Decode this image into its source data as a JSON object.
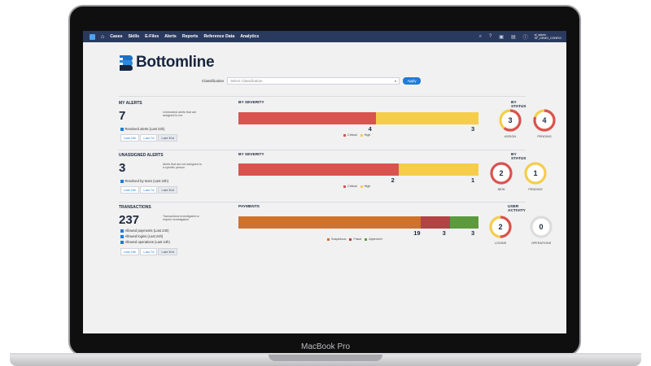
{
  "device": {
    "model": "MacBook Pro"
  },
  "nav": {
    "home_icon": "home-icon",
    "items": [
      "Cases",
      "Skills",
      "E-Files",
      "Alerts",
      "Reports",
      "Reference Data",
      "Analytics"
    ],
    "icons": [
      "search-icon",
      "help-icon",
      "briefcase-icon",
      "print-icon",
      "info-icon"
    ],
    "user_line1": "sf_admin",
    "user_line2": "SF_DEMO_CONFIG"
  },
  "brand": {
    "name": "Bottomline"
  },
  "filter": {
    "label": "Classification",
    "placeholder": "Select Classification",
    "apply": "Apply"
  },
  "colors": {
    "critical": "#d9534f",
    "high": "#f5cd4a",
    "suspicious": "#d0712c",
    "fraud": "#b24443",
    "approved": "#5c9a3c",
    "nav": "#2a3a5e",
    "accent": "#1f7bd8"
  },
  "my_alerts": {
    "title": "MY ALERTS",
    "count": "7",
    "description": "Unresolved alerts that are assigned to me",
    "checks": [
      "Resolved alerts (Last 24h)"
    ],
    "ranges": [
      "Last 24h",
      "Last 7d",
      "Last 30d"
    ],
    "severity_title": "BY SEVERITY",
    "critical": 4,
    "high": 3,
    "critical_label": "Critical",
    "high_label": "High",
    "status_title": "BY STATUS",
    "status": [
      {
        "value": "3",
        "label": "ASSIGN",
        "fill": 0.6
      },
      {
        "value": "4",
        "label": "PENDING",
        "fill": 0.8
      }
    ]
  },
  "unassigned_alerts": {
    "title": "UNASSIGNED ALERTS",
    "count": "3",
    "description": "Alerts that are not assigned to a specific person",
    "checks": [
      "Resolved by team (Last 24h)"
    ],
    "ranges": [
      "Last 24h",
      "Last 7d",
      "Last 30d"
    ],
    "severity_title": "BY SEVERITY",
    "critical": 2,
    "high": 1,
    "critical_label": "Critical",
    "high_label": "High",
    "status_title": "BY STATUS",
    "status": [
      {
        "value": "2",
        "label": "NEW",
        "fill": 1.0
      },
      {
        "value": "1",
        "label": "PENDING",
        "fill": 1.0
      }
    ]
  },
  "transactions": {
    "title": "TRANSACTIONS",
    "count": "237",
    "description": "Transactions investigated or require investigation",
    "checks": [
      "Allowed payments (Last 24h)",
      "Allowed logins (Last 24h)",
      "Allowed operations (Last 24h)"
    ],
    "ranges": [
      "Last 24h",
      "Last 7d",
      "Last 30d"
    ],
    "payments_title": "PAYMENTS",
    "suspicious": 19,
    "fraud": 3,
    "approved": 3,
    "suspicious_label": "Suspicious",
    "fraud_label": "Fraud",
    "approved_label": "Approved",
    "activity_title": "USER ACTIVITY",
    "activity": [
      {
        "value": "2",
        "label": "LOGINS",
        "fill": 0.5
      },
      {
        "value": "0",
        "label": "OPERATIONS",
        "fill": 0.0
      }
    ]
  }
}
